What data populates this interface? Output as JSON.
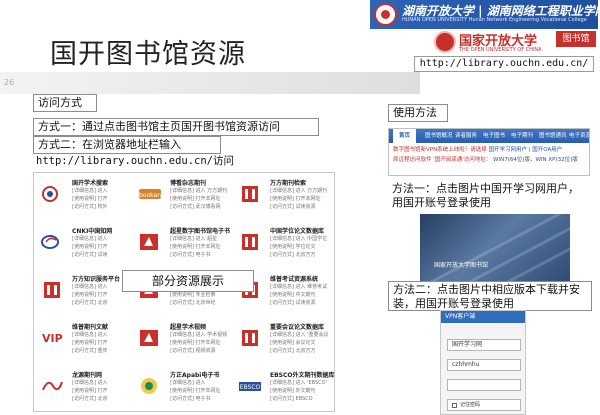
{
  "slide": {
    "title": "国开图书馆资源",
    "page_number": "26",
    "url_top": "http://library.ouchn.edu.cn/"
  },
  "logos": {
    "hunan_name": "湖南开放大学 | 湖南网络工程职业学院",
    "hunan_sub": "HUNAN OPEN UNIVERSITY   Hunan Network Engineering Vocational College",
    "ouchn_name": "国家开放大学",
    "ouchn_sub": "THE OPEN UNIVERSITY OF CHINA",
    "ouchn_badge": "图书馆"
  },
  "access": {
    "header": "访问方式",
    "method1": "方式一：通过点击图书馆主页国开图书馆资源访问",
    "method2": "方式二：在浏览器地址栏输入",
    "url_line": "http://library.ouchn.edu.cn/访问"
  },
  "usage": {
    "header": "使用方法",
    "method1_l1": "方法一：点击图片中国开学习网用户，",
    "method1_l2": "用国开账号登录使用",
    "method2_l1": "方法二：点击图片中相应版本下载并安",
    "method2_l2": "装，用国开账号登录使用"
  },
  "showcase_label": "部分资源展示",
  "databases": [
    {
      "name": "国开学术搜索",
      "logo": "search-globe",
      "color": "#c8302c",
      "lines": [
        "[详细信息]  进入",
        "[使用说明]  打开",
        "[访问方式]  校外"
      ]
    },
    {
      "name": "博看杂志期刊",
      "logo": "bookan",
      "color": "#d9822b",
      "lines": [
        "[详细信息]  进入 万方期刊",
        "[使用说明]  打开本网址",
        "[访问方式]  武汉博看网"
      ]
    },
    {
      "name": "万方期刊检索",
      "logo": "wanfang",
      "color": "#c8302c",
      "lines": [
        "[详细信息]  进入 万方期刊",
        "[使用说明]  打开本网址",
        "[访问方式]  试读资源"
      ]
    },
    {
      "name": "CNKI中国知网",
      "logo": "cnki",
      "color": "#2a4f9e",
      "lines": [
        "[详细信息]  进入",
        "[使用说明]  打开",
        "[访问方式]  试读"
      ]
    },
    {
      "name": "超星数字图书馆电子书",
      "logo": "chaoxing",
      "color": "#c8302c",
      "lines": [
        "[详细信息]  进入 超星",
        "[使用说明]  打开本网址",
        "[访问方式]  电子书"
      ]
    },
    {
      "name": "中国学位论文数据库",
      "logo": "wanfang",
      "color": "#c8302c",
      "lines": [
        "[详细信息]  进入 中国学位",
        "[使用说明]  学位论文",
        "[访问方式]  北京万方"
      ]
    },
    {
      "name": "万方知识服务平台",
      "logo": "wanfang",
      "color": "#c8302c",
      "lines": [
        "[详细信息]  进入",
        "[使用说明]  打开",
        "[访问方式]  北京"
      ]
    },
    {
      "name": "超星发现系统",
      "logo": "chaoxing",
      "color": "#c8302c",
      "lines": [
        "[详细信息]  进入",
        "[使用说明]  专业检索",
        "[访问方式]  北京世纪"
      ]
    },
    {
      "name": "维普考试资源系统",
      "logo": "wanfang",
      "color": "#c8302c",
      "lines": [
        "[详细信息]  进入 维普考试",
        "[使用说明]  中文期刊",
        "[访问方式]  试读资源"
      ]
    },
    {
      "name": "维普期刊文献",
      "logo": "vip",
      "color": "#c8302c",
      "lines": [
        "[详细信息]  进入",
        "[使用说明]  打开",
        "[访问方式]  重庆"
      ]
    },
    {
      "name": "超星学术视频",
      "logo": "chaoxing",
      "color": "#c8302c",
      "lines": [
        "[详细信息]  进入 学术视频",
        "[使用说明]  打开本网址",
        "[访问方式]  视频资源"
      ]
    },
    {
      "name": "重要会议论文数据库",
      "logo": "wanfang",
      "color": "#c8302c",
      "lines": [
        "[详细信息]  进入 '重要会议",
        "[使用说明]  会议论文",
        "[访问方式]  北京万方"
      ]
    },
    {
      "name": "龙源期刊网",
      "logo": "longyuan",
      "color": "#c8302c",
      "lines": [
        "[详细信息]  进入",
        "[使用说明]  打开",
        "[访问方式]  北京"
      ]
    },
    {
      "name": "方正Apabi电子书",
      "logo": "apabi",
      "color": "#1f8f4e",
      "lines": [
        "[详细信息]  进入",
        "[使用说明]  打开本网址",
        "[访问方式]  电子书"
      ]
    },
    {
      "name": "EBSCO外文期刊数据库",
      "logo": "ebsco",
      "color": "#2a4f9e",
      "lines": [
        "[详细信息]  进入 'EBSCO'",
        "[使用说明]  外文期刊",
        "[访问方式]  EBSCO"
      ]
    }
  ],
  "nav_screenshot": {
    "tabs": [
      "首页",
      "图书馆概况",
      "读者服务",
      "电子图书",
      "电子期刊",
      "图书馆通讯",
      "电子资源"
    ],
    "note1_prefix": "数字图书馆新VPN系统上线啦！请选择",
    "note1_links": "国开学习网用户 | 国开OA用户",
    "note2_prefix": "原远程访问软件 '国开阅读通'访问地址：",
    "note2_links": "WIN7(64位)版，WIN XP(32位)版"
  },
  "login_screenshot": {
    "caption": "国家开放大学图书馆"
  },
  "vpn_screenshot": {
    "header": "VPN客户端",
    "field1": "国开学习网",
    "field2": "czhhmhu",
    "field3": "",
    "remember": "记住密码"
  },
  "colors": {
    "hunan_blue": "#2d63b8",
    "ouchn_red": "#c8302c",
    "link_blue": "#2a4f9e"
  }
}
